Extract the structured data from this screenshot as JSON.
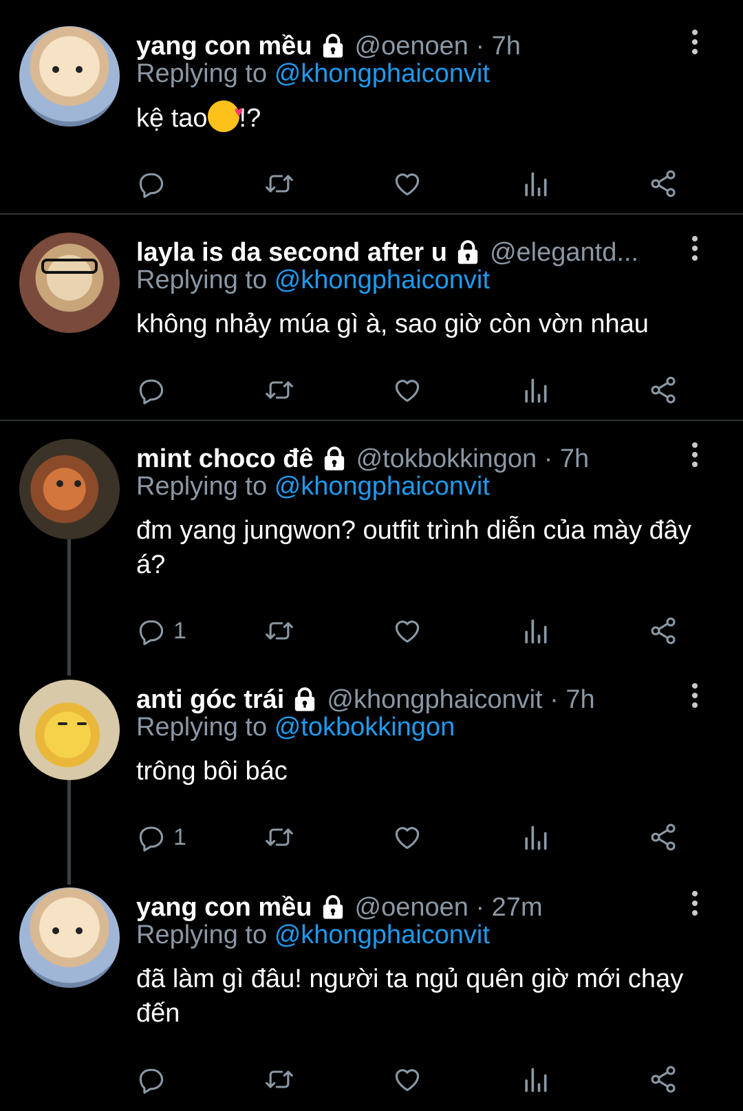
{
  "tweets": [
    {
      "name": "yang con mều",
      "handle": "@oenoen",
      "time": "7h",
      "replying_label": "Replying to",
      "replying_to": "@khongphaiconvit",
      "text_before": "kệ tao",
      "emoji": "smiling-face-with-hearts",
      "text_after": "!?",
      "reply_count": "",
      "avatar": "cat-avatar"
    },
    {
      "name": "layla is da second after u",
      "handle": "@elegantd...",
      "time": "",
      "replying_label": "Replying to",
      "replying_to": "@khongphaiconvit",
      "text": "không nhảy múa gì à, sao giờ còn vờn nhau",
      "reply_count": "",
      "avatar": "dog-with-glasses-avatar"
    },
    {
      "name": "mint choco đê",
      "handle": "@tokbokkingon",
      "time": "7h",
      "replying_label": "Replying to",
      "replying_to": "@khongphaiconvit",
      "text": "đm yang jungwon? outfit trình diễn của mày đây á?",
      "reply_count": "1",
      "avatar": "fox-avatar"
    },
    {
      "name": "anti góc trái",
      "handle": "@khongphaiconvit",
      "time": "7h",
      "replying_label": "Replying to",
      "replying_to": "@tokbokkingon",
      "text": "trông bôi bác",
      "reply_count": "1",
      "avatar": "duck-avatar"
    },
    {
      "name": "yang con mều",
      "handle": "@oenoen",
      "time": "27m",
      "replying_label": "Replying to",
      "replying_to": "@khongphaiconvit",
      "text": "đã làm gì đâu! người ta ngủ quên giờ mới chạy đến",
      "reply_count": "",
      "avatar": "cat-avatar"
    }
  ],
  "colors": {
    "background": "#000000",
    "secondary_text": "#8b98a5",
    "mention": "#1d9bf0",
    "separator": "#2f3336"
  },
  "icons": [
    "reply-icon",
    "retweet-icon",
    "like-icon",
    "analytics-icon",
    "share-icon",
    "lock-icon",
    "more-icon"
  ]
}
